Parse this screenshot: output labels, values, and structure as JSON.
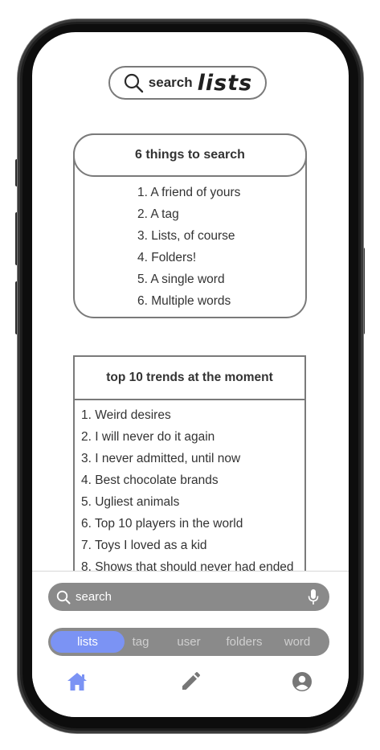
{
  "top_search": {
    "label": "search",
    "brand": "lists",
    "icon": "search-icon"
  },
  "things_card": {
    "title": "6 things to search",
    "items": [
      "1. A friend of yours",
      "2. A tag",
      "3. Lists, of course",
      "4. Folders!",
      "5. A single word",
      "6. Multiple words"
    ]
  },
  "trends_card": {
    "title": "top 10 trends at the moment",
    "items": [
      "1. Weird desires",
      "2. I will never do it again",
      "3. I never admitted, until now",
      "4. Best chocolate brands",
      "5. Ugliest animals",
      "6. Top 10 players in the world",
      "7. Toys I loved as a kid",
      "8. Shows that should never had ended"
    ]
  },
  "search_bar": {
    "placeholder": "search",
    "icon": "search-icon",
    "mic_icon": "microphone-icon"
  },
  "filters": [
    {
      "label": "lists",
      "active": true
    },
    {
      "label": "tag",
      "active": false
    },
    {
      "label": "user",
      "active": false
    },
    {
      "label": "folders",
      "active": false
    },
    {
      "label": "word",
      "active": false
    }
  ],
  "nav": {
    "home_icon": "home-icon",
    "edit_icon": "pencil-icon",
    "profile_icon": "profile-icon"
  },
  "colors": {
    "accent": "#7b93f4",
    "bar_gray": "#8a8a8a",
    "border_gray": "#7a7a7a",
    "text_dark": "#333333"
  }
}
